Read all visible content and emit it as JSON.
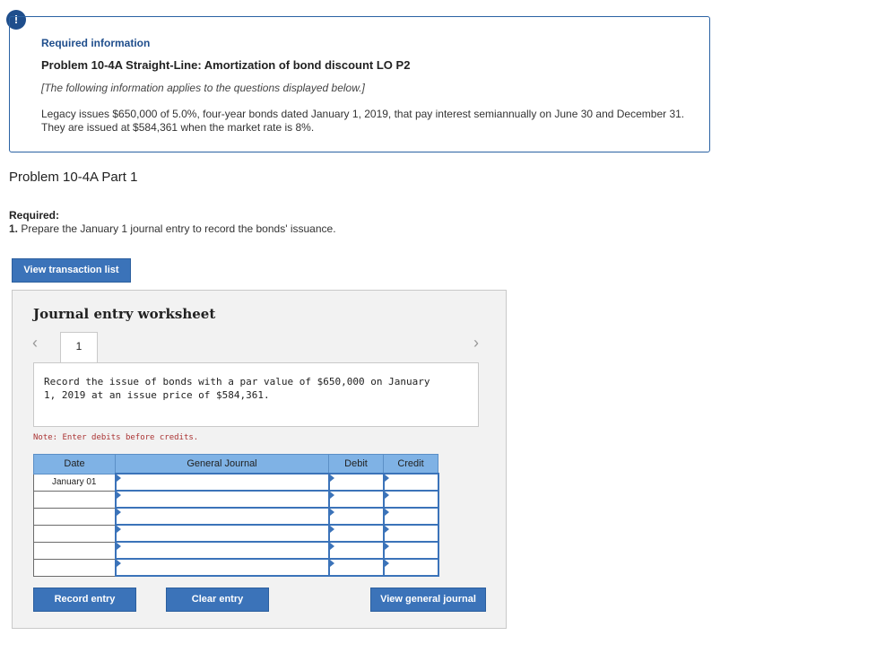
{
  "alert": {
    "icon": "exclamation-icon",
    "glyph": "!"
  },
  "info": {
    "heading": "Required information",
    "problem_title": "Problem 10-4A Straight-Line: Amortization of bond discount LO P2",
    "applies_note": "[The following information applies to the questions displayed below.]",
    "description": "Legacy issues $650,000 of 5.0%, four-year bonds dated January 1, 2019, that pay interest semiannually on June 30 and December 31. They are issued at $584,361 when the market rate is 8%."
  },
  "part": {
    "title": "Problem 10-4A Part 1",
    "required_label": "Required:",
    "item_number": "1.",
    "item_text": "Prepare the January 1 journal entry to record the bonds' issuance."
  },
  "buttons": {
    "view_transaction_list": "View transaction list",
    "record_entry": "Record entry",
    "clear_entry": "Clear entry",
    "view_general_journal": "View general journal"
  },
  "worksheet": {
    "title": "Journal entry worksheet",
    "prev_glyph": "‹",
    "next_glyph": "›",
    "tabs": [
      "1"
    ],
    "instruction": "Record the issue of bonds with a par value of $650,000 on January 1, 2019 at an issue price of $584,361.",
    "note": "Note: Enter debits before credits.",
    "table": {
      "headers": [
        "Date",
        "General Journal",
        "Debit",
        "Credit"
      ],
      "rows": [
        {
          "date": "January 01",
          "account": "",
          "debit": "",
          "credit": ""
        },
        {
          "date": "",
          "account": "",
          "debit": "",
          "credit": ""
        },
        {
          "date": "",
          "account": "",
          "debit": "",
          "credit": ""
        },
        {
          "date": "",
          "account": "",
          "debit": "",
          "credit": ""
        },
        {
          "date": "",
          "account": "",
          "debit": "",
          "credit": ""
        },
        {
          "date": "",
          "account": "",
          "debit": "",
          "credit": ""
        }
      ]
    }
  },
  "colors": {
    "accent": "#3b73b9",
    "header_fill": "#7fb2e5",
    "note_red": "#aa3333"
  }
}
